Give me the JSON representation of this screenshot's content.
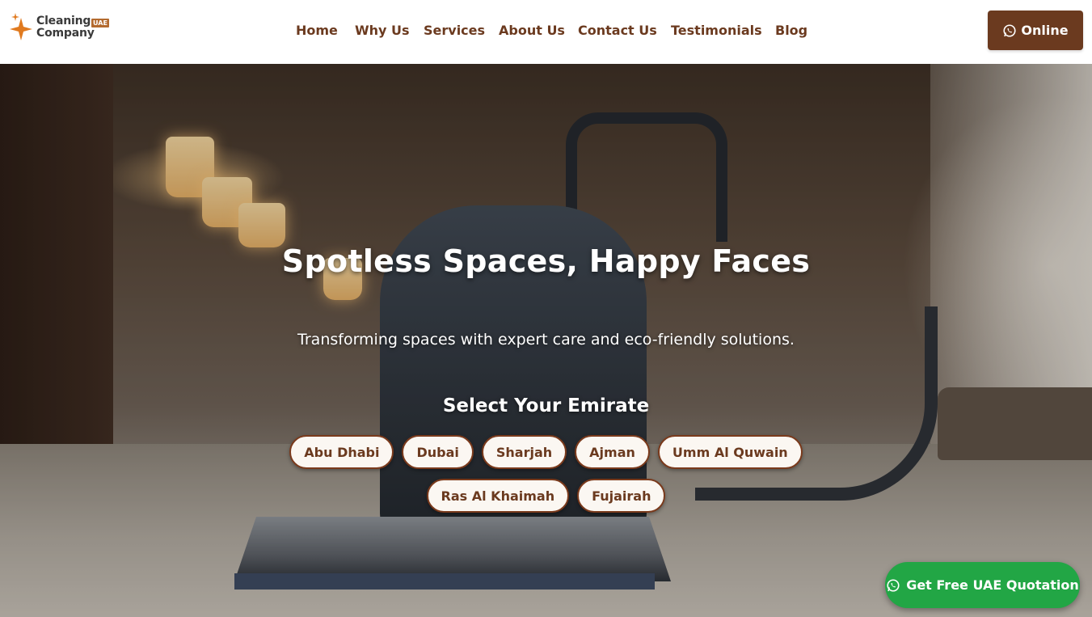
{
  "header": {
    "logo": {
      "line1": "Cleaning",
      "line2": "Company",
      "badge": "UAE"
    },
    "nav": [
      {
        "label": "Home"
      },
      {
        "label": "Why Us"
      },
      {
        "label": "Services"
      },
      {
        "label": "About Us"
      },
      {
        "label": "Contact Us"
      },
      {
        "label": "Testimonials"
      },
      {
        "label": "Blog"
      }
    ],
    "online_button": {
      "label": "Online",
      "icon": "whatsapp-icon"
    }
  },
  "hero": {
    "title": "Spotless Spaces, Happy Faces",
    "subtitle": "Transforming spaces with expert care and eco-friendly solutions.",
    "select_label": "Select Your Emirate",
    "emirates_row1": [
      "Abu Dhabi",
      "Dubai",
      "Sharjah",
      "Ajman",
      "Umm Al Quwain"
    ],
    "emirates_row2": [
      "Ras Al Khaimah",
      "Fujairah"
    ]
  },
  "floating": {
    "quote_button": {
      "label": "Get Free UAE Quotation",
      "icon": "whatsapp-icon"
    }
  },
  "colors": {
    "brand_brown": "#6b3a1f",
    "logo_orange": "#e07a1f",
    "whatsapp_green": "#22a645",
    "white": "#ffffff"
  }
}
